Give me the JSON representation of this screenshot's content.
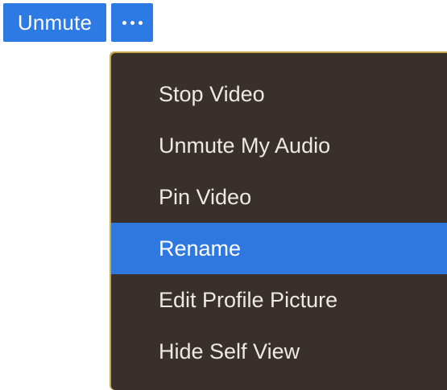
{
  "toolbar": {
    "unmute_label": "Unmute",
    "more_icon": "more-horizontal-icon"
  },
  "menu": {
    "items": [
      {
        "label": "Stop Video"
      },
      {
        "label": "Unmute My Audio"
      },
      {
        "label": "Pin Video"
      },
      {
        "label": "Rename",
        "active": true
      },
      {
        "label": "Edit Profile Picture"
      },
      {
        "label": "Hide Self View"
      }
    ]
  },
  "colors": {
    "accent": "#2d7ae5",
    "menu_background": "#3a302b",
    "menu_highlight": "#2f78e0",
    "menu_border": "#c9a84a"
  }
}
